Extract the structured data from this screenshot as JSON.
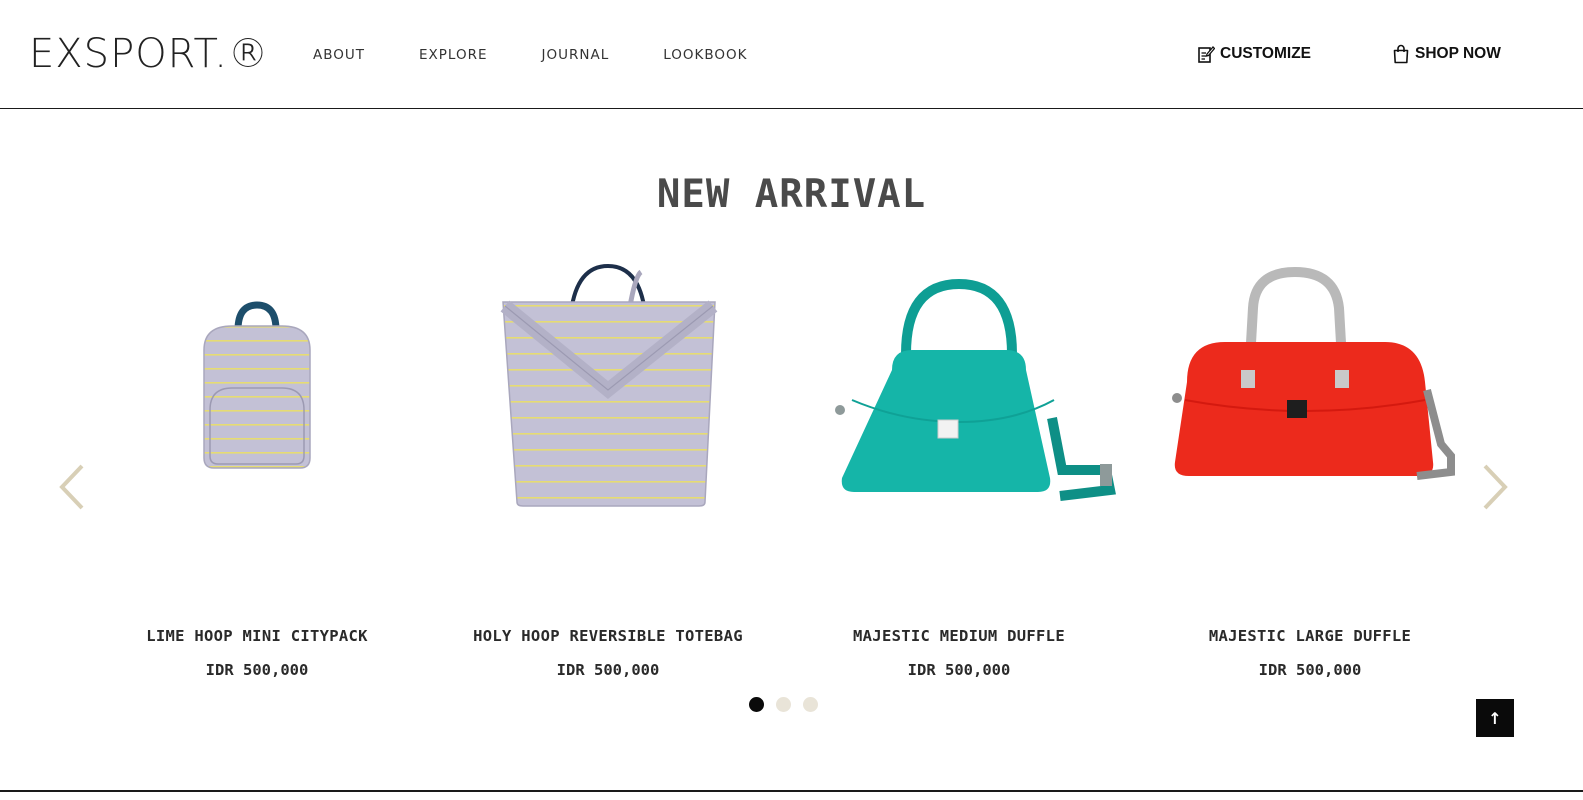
{
  "header": {
    "logo": "EXSPORT.®",
    "nav": [
      "ABOUT",
      "EXPLORE",
      "JOURNAL",
      "LOOKBOOK"
    ],
    "customize_label": "CUSTOMIZE",
    "shop_label": "SHOP NOW",
    "customize_icon": "edit-note-icon",
    "shop_icon": "shopping-bag-icon"
  },
  "section": {
    "title": "NEW ARRIVAL"
  },
  "products": [
    {
      "name": "LIME HOOP MINI CITYPACK",
      "price": "IDR 500,000",
      "color": "#c3c1d6"
    },
    {
      "name": "HOLY HOOP REVERSIBLE TOTEBAG",
      "price": "IDR 500,000",
      "color": "#c3c1d6"
    },
    {
      "name": "MAJESTIC MEDIUM DUFFLE",
      "price": "IDR 500,000",
      "color": "#15b5a8"
    },
    {
      "name": "MAJESTIC LARGE DUFFLE",
      "price": "IDR 500,000",
      "color": "#ec2a1c"
    }
  ],
  "carousel": {
    "prev_icon": "chevron-left-icon",
    "next_icon": "chevron-right-icon",
    "pages": 3,
    "active_page": 1
  },
  "back_to_top_icon": "arrow-up-icon",
  "back_to_top_glyph": "↑",
  "colors": {
    "accent_arrow": "#d8cfb6",
    "dot_inactive": "#e9e4d8",
    "dot_active": "#0a0a0a"
  }
}
